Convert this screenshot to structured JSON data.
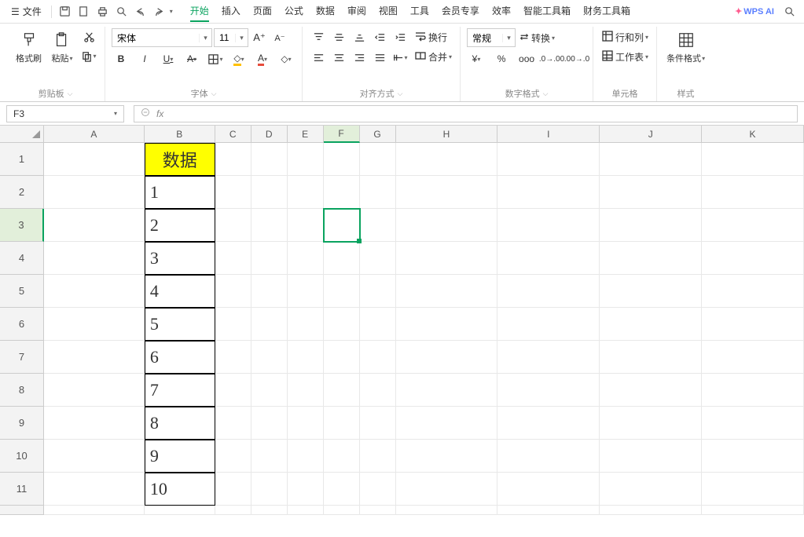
{
  "menubar": {
    "file": "文件",
    "tabs": [
      "开始",
      "插入",
      "页面",
      "公式",
      "数据",
      "审阅",
      "视图",
      "工具",
      "会员专享",
      "效率",
      "智能工具箱",
      "财务工具箱"
    ],
    "active_tab": 0,
    "wps_ai": "WPS AI"
  },
  "ribbon": {
    "clipboard": {
      "format_painter": "格式刷",
      "paste": "粘贴",
      "label": "剪贴板"
    },
    "font": {
      "name": "宋体",
      "size": "11",
      "label": "字体"
    },
    "align": {
      "wrap": "换行",
      "merge": "合并",
      "label": "对齐方式"
    },
    "number": {
      "general": "常规",
      "convert": "转换",
      "label": "数字格式"
    },
    "cells": {
      "rowcol": "行和列",
      "sheet": "工作表",
      "label": "单元格"
    },
    "style": {
      "cond": "条件格式",
      "label": "样式"
    }
  },
  "namebox": "F3",
  "formula": "",
  "columns": [
    "A",
    "B",
    "C",
    "D",
    "E",
    "F",
    "G",
    "H",
    "I",
    "J",
    "K"
  ],
  "active_col": "F",
  "active_row": 3,
  "rows": [
    1,
    2,
    3,
    4,
    5,
    6,
    7,
    8,
    9,
    10,
    11
  ],
  "cells": {
    "B1": "数据",
    "B2": "1",
    "B3": "2",
    "B4": "3",
    "B5": "4",
    "B6": "5",
    "B7": "6",
    "B8": "7",
    "B9": "8",
    "B10": "9",
    "B11": "10"
  }
}
